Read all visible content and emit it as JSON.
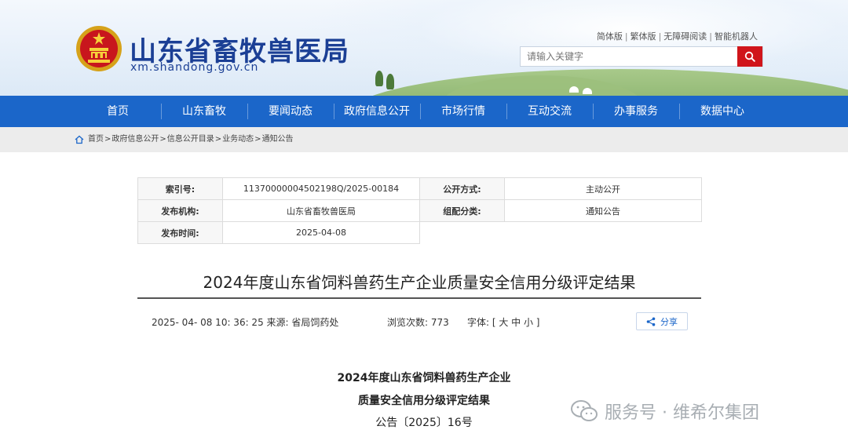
{
  "header": {
    "site_title": "山东省畜牧兽医局",
    "site_domain": "xm.shandong.gov.cn",
    "top_links": [
      "简体版",
      "繁体版",
      "无障碍阅读",
      "智能机器人"
    ],
    "search": {
      "placeholder": "请输入关键字"
    }
  },
  "nav": {
    "items": [
      "首页",
      "山东畜牧",
      "要闻动态",
      "政府信息公开",
      "市场行情",
      "互动交流",
      "办事服务",
      "数据中心"
    ]
  },
  "breadcrumb": [
    "首页",
    "政府信息公开",
    "信息公开目录",
    "业务动态",
    "通知公告"
  ],
  "meta": {
    "index_label": "索引号:",
    "index_value": "11370000004502198Q/2025-00184",
    "disclosure_label": "公开方式:",
    "disclosure_value": "主动公开",
    "issuer_label": "发布机构:",
    "issuer_value": "山东省畜牧兽医局",
    "category_label": "组配分类:",
    "category_value": "通知公告",
    "date_label": "发布时间:",
    "date_value": "2025-04-08"
  },
  "article": {
    "title": "2024年度山东省饲料兽药生产企业质量安全信用分级评定结果",
    "datetime_source": "2025- 04- 08 10: 36: 25 来源:   省局饲药处",
    "views": "浏览次数: 773",
    "font_size": "字体: [ 大 中 小 ]",
    "share_label": "分享",
    "body_line1": "2024年度山东省饲料兽药生产企业",
    "body_line2": "质量安全信用分级评定结果",
    "body_line3": "公告〔2025〕16号"
  },
  "watermark": "服务号 · 维希尔集团",
  "colors": {
    "nav_blue": "#1b66c9",
    "title_blue": "#1b3f95",
    "search_red": "#d0151b"
  }
}
